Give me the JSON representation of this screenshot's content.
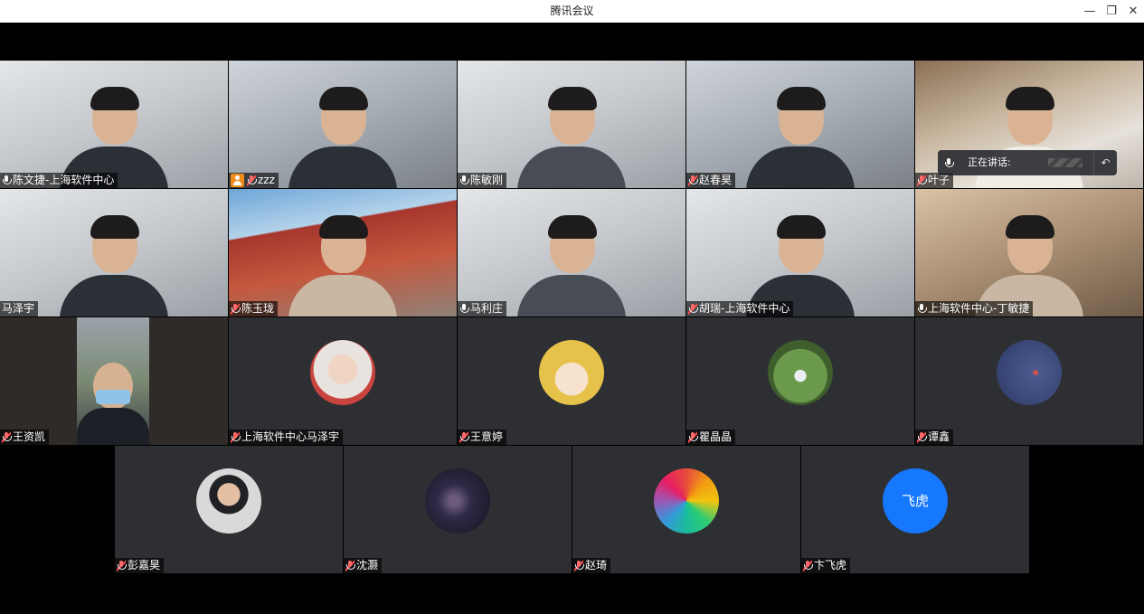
{
  "window": {
    "title": "腾讯会议",
    "minimize_label": "—",
    "restore_label": "❐",
    "close_label": "✕"
  },
  "speaking_indicator": {
    "label": "正在讲话:",
    "back_label": "↶"
  },
  "participants": [
    {
      "name": "陈文捷-上海软件中心",
      "mic": "on",
      "mode": "video"
    },
    {
      "name": "zzz",
      "mic": "muted",
      "mode": "video",
      "host": true
    },
    {
      "name": "陈敏刚",
      "mic": "on",
      "mode": "video"
    },
    {
      "name": "赵春昊",
      "mic": "muted",
      "mode": "video"
    },
    {
      "name": "叶子",
      "mic": "muted",
      "mode": "video"
    },
    {
      "name": "马泽宇",
      "mic": "none",
      "mode": "video"
    },
    {
      "name": "陈玉珑",
      "mic": "muted",
      "mode": "video"
    },
    {
      "name": "马利庄",
      "mic": "on",
      "mode": "video"
    },
    {
      "name": "胡瑞-上海软件中心",
      "mic": "muted",
      "mode": "video"
    },
    {
      "name": "上海软件中心-丁敏捷",
      "mic": "on",
      "mode": "video"
    },
    {
      "name": "王资凯",
      "mic": "muted",
      "mode": "video"
    },
    {
      "name": "上海软件中心马泽宇",
      "mic": "muted",
      "mode": "avatar",
      "avatar_icon": "baby-photo-icon"
    },
    {
      "name": "王意婷",
      "mic": "muted",
      "mode": "avatar",
      "avatar_icon": "anime-girl-icon"
    },
    {
      "name": "瞿晶晶",
      "mic": "muted",
      "mode": "avatar",
      "avatar_icon": "fountain-photo-icon"
    },
    {
      "name": "谭鑫",
      "mic": "muted",
      "mode": "avatar",
      "avatar_icon": "night-sky-icon"
    },
    {
      "name": "彭嘉昊",
      "mic": "muted",
      "mode": "avatar",
      "avatar_icon": "man-portrait-icon"
    },
    {
      "name": "沈灏",
      "mic": "muted",
      "mode": "avatar",
      "avatar_icon": "city-night-icon"
    },
    {
      "name": "赵琦",
      "mic": "muted",
      "mode": "avatar",
      "avatar_icon": "color-wheel-icon"
    },
    {
      "name": "卞飞虎",
      "mic": "muted",
      "mode": "avatar",
      "avatar_icon": "text-avatar",
      "avatar_text": "飞虎",
      "avatar_color": "#1677ff"
    }
  ]
}
